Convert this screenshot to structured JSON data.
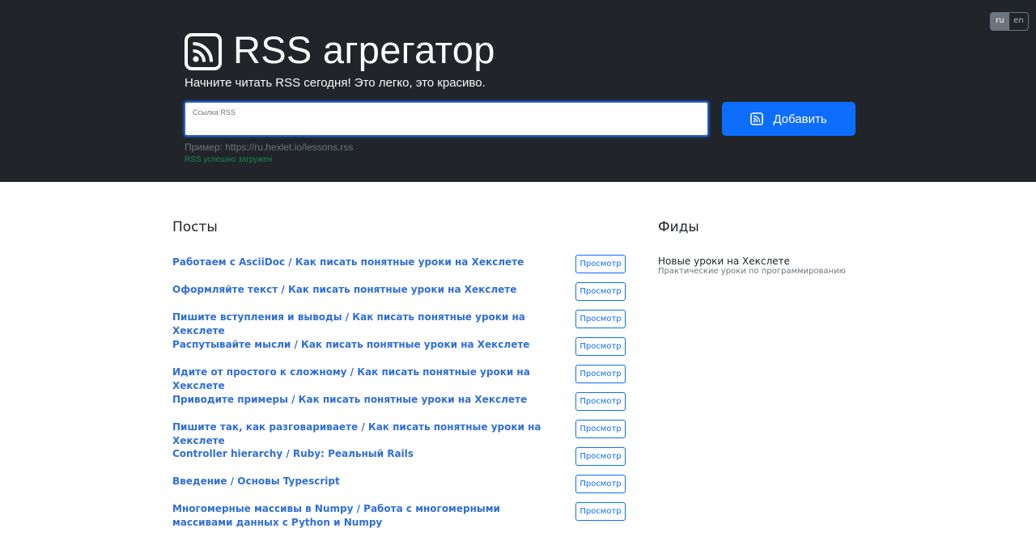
{
  "header": {
    "title": "RSS агрегатор",
    "lead": "Начните читать RSS сегодня! Это легко, это красиво.",
    "colors": {
      "background": "#212529",
      "primary": "#0d6efd",
      "success": "#198754"
    }
  },
  "language": {
    "options": [
      "ru",
      "en"
    ],
    "selected": "ru"
  },
  "form": {
    "input_label": "Ссылка RSS",
    "input_value": "",
    "add_button_label": "Добавить",
    "add_button_icon": "rss-icon",
    "example": "Пример: https://ru.hexlet.io/lessons.rss",
    "feedback": "RSS успешно загружен"
  },
  "posts": {
    "title": "Посты",
    "view_button_label": "Просмотр",
    "items": [
      {
        "title": "Работаем с AsciiDoc / Как писать понятные уроки на Хекслете"
      },
      {
        "title": "Оформляйте текст / Как писать понятные уроки на Хекслете"
      },
      {
        "title": "Пишите вступления и выводы / Как писать понятные уроки на Хекслете"
      },
      {
        "title": "Распутывайте мысли / Как писать понятные уроки на Хекслете"
      },
      {
        "title": "Идите от простого к сложному / Как писать понятные уроки на Хекслете"
      },
      {
        "title": "Приводите примеры / Как писать понятные уроки на Хекслете"
      },
      {
        "title": "Пишите так, как разговариваете / Как писать понятные уроки на Хекслете"
      },
      {
        "title": "Controller hierarchy / Ruby: Реальный Rails"
      },
      {
        "title": "Введение / Основы Typescript"
      },
      {
        "title": "Многомерные массивы в Numpy / Работа с многомерными массивами данных с Python и Numpy"
      }
    ]
  },
  "feeds": {
    "title": "Фиды",
    "items": [
      {
        "title": "Новые уроки на Хекслете",
        "description": "Практические уроки по программированию"
      }
    ]
  }
}
